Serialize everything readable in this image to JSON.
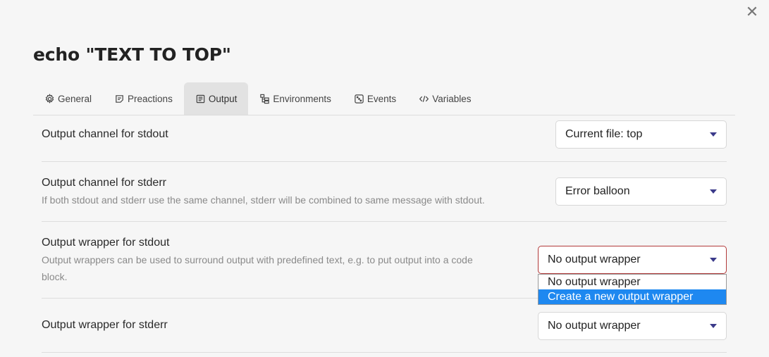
{
  "dialog": {
    "title": "echo \"TEXT TO TOP\"",
    "close_symbol": "✕"
  },
  "tabs": [
    {
      "label": "General",
      "icon": "gear-icon"
    },
    {
      "label": "Preactions",
      "icon": "note-icon"
    },
    {
      "label": "Output",
      "icon": "document-icon",
      "active": true
    },
    {
      "label": "Environments",
      "icon": "tree-icon"
    },
    {
      "label": "Events",
      "icon": "dice-icon"
    },
    {
      "label": "Variables",
      "icon": "code-icon"
    }
  ],
  "settings": {
    "stdout_channel": {
      "label": "Output channel for stdout",
      "value": "Current file: top"
    },
    "stderr_channel": {
      "label": "Output channel for stderr",
      "description": "If both stdout and stderr use the same channel, stderr will be combined to same message with stdout.",
      "value": "Error balloon"
    },
    "stdout_wrapper": {
      "label": "Output wrapper for stdout",
      "description_line1": "Output wrappers can be used to surround output with predefined text, e.g. to put output into a code",
      "description_line2": "block.",
      "value": "No output wrapper",
      "options": [
        "No output wrapper",
        "Create a new output wrapper"
      ],
      "highlighted_option": "Create a new output wrapper"
    },
    "stderr_wrapper": {
      "label": "Output wrapper for stderr",
      "value": "No output wrapper"
    }
  },
  "colors": {
    "accent_caret": "#3b3a8a",
    "focus_border": "#b23a3a",
    "highlight": "#1e88f0"
  }
}
